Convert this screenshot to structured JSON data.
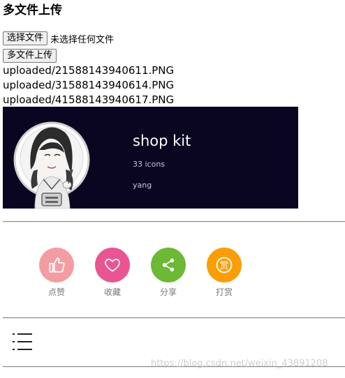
{
  "heading": "多文件上传",
  "file_input": {
    "button_label": "选择文件",
    "status": "未选择任何文件"
  },
  "upload_button_label": "多文件上传",
  "uploaded_files": [
    "uploaded/21588143940611.PNG",
    "uploaded/31588143940614.PNG",
    "uploaded/41588143940617.PNG"
  ],
  "banner": {
    "title": "shop kit",
    "count": "33 icons",
    "author": "yang"
  },
  "actions": [
    {
      "label": "点赞",
      "icon": "thumbs-up-icon",
      "color": "#f39da2"
    },
    {
      "label": "收藏",
      "icon": "heart-icon",
      "color": "#e85592"
    },
    {
      "label": "分享",
      "icon": "share-icon",
      "color": "#6db834"
    },
    {
      "label": "打赏",
      "icon": "reward-icon",
      "color": "#fb9d05"
    }
  ],
  "watermark": "https://blog.csdn.net/weixin_43891208"
}
